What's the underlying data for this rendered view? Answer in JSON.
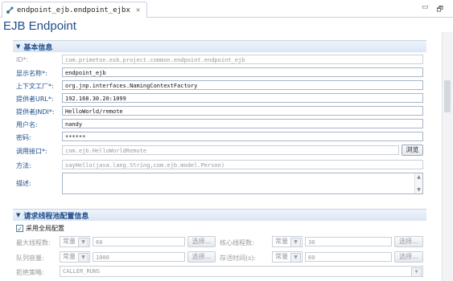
{
  "tab": {
    "title": "endpoint_ejb.endpoint_ejbx",
    "close_glyph": "✕"
  },
  "window_buttons": {
    "minimize": "▭",
    "maximize": "🗗"
  },
  "page_title": "EJB Endpoint",
  "basic": {
    "header": "基本信息",
    "fields": [
      {
        "label": "ID*:",
        "value": "com.primeton.esb.project.common.endpoint.endpoint_ejb",
        "disabled": true
      },
      {
        "label": "显示名称*:",
        "value": "endpoint_ejb",
        "disabled": false
      },
      {
        "label": "上下文工厂*:",
        "value": "org.jnp.interfaces.NamingContextFactory",
        "disabled": false
      },
      {
        "label": "提供者URL*:",
        "value": "192.168.30.20:1099",
        "disabled": false
      },
      {
        "label": "提供者JNDI*:",
        "value": "HelloWorld/remote",
        "disabled": false
      },
      {
        "label": "用户名:",
        "value": "nandy",
        "disabled": false
      },
      {
        "label": "密码:",
        "value": "******",
        "disabled": false
      },
      {
        "label": "调用接口*:",
        "value": "com.ejb.HelloWorldRemote",
        "disabled": true
      },
      {
        "label": "方法:",
        "value": "sayHello(java.lang.String,com.ejb.model.Person)",
        "disabled": true
      },
      {
        "label": "描述:",
        "value": "",
        "disabled": false
      }
    ],
    "browse_button": "浏览"
  },
  "thread_pool": {
    "header": "请求线程池配置信息",
    "use_global_label": "采用全局配置",
    "use_global_checked": true,
    "max_threads": {
      "label": "最大线程数:",
      "mode": "常量",
      "value": "60",
      "choose": "选择..."
    },
    "core_threads": {
      "label": "核心线程数:",
      "mode": "常量",
      "value": "30",
      "choose": "选择..."
    },
    "queue_capacity": {
      "label": "队列容量:",
      "mode": "常量",
      "value": "1000",
      "choose": "选择..."
    },
    "keep_alive": {
      "label": "存活时间(s):",
      "mode": "常量",
      "value": "60",
      "choose": "选择..."
    },
    "reject_policy": {
      "label": "拒绝策略:",
      "value": "CALLER_RUNS"
    }
  }
}
